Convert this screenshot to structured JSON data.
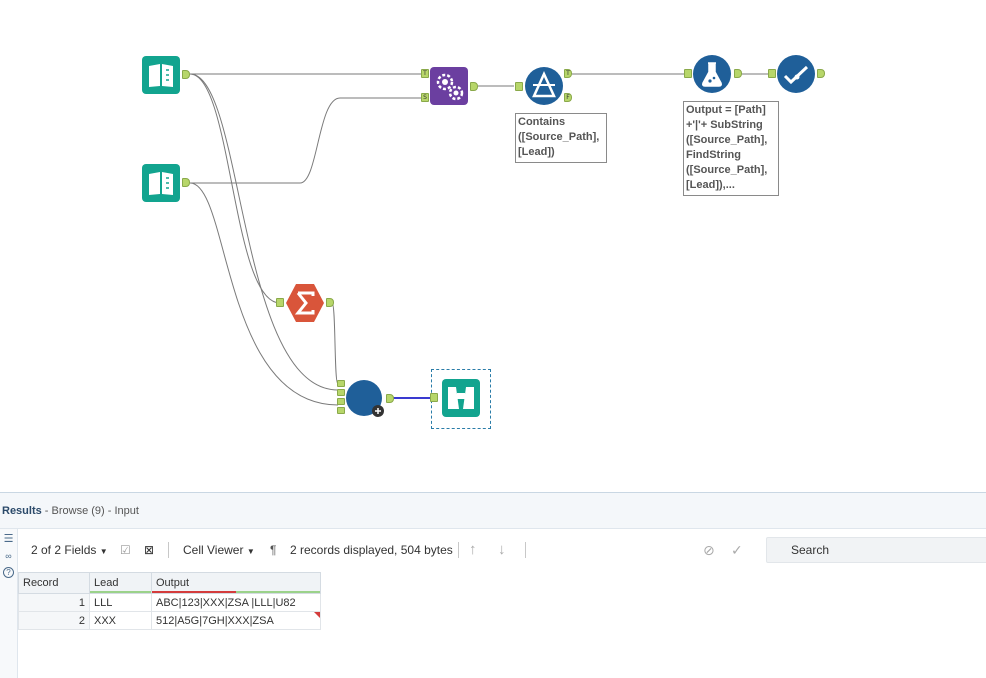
{
  "annotations": {
    "filter": "Contains\n([Source_Path],\n[Lead])",
    "formula": "Output = [Path]\n+'|'+ SubString\n([Source_Path],\nFindString\n([Source_Path],\n[Lead]),..."
  },
  "anchors": {
    "true": "T",
    "false": "F",
    "source": "S"
  },
  "results": {
    "title": "Results",
    "subtitle": " - Browse (9) - Input",
    "fields_label": "2 of 2 Fields",
    "cell_viewer_label": "Cell Viewer",
    "records_info": "2 records displayed, 504 bytes",
    "search_placeholder": "Search",
    "columns": [
      "Record",
      "Lead",
      "Output"
    ],
    "rows": [
      {
        "record": "1",
        "lead": "LLL",
        "output": "ABC|123|XXX|ZSA |LLL|U82"
      },
      {
        "record": "2",
        "lead": "XXX",
        "output": "512|A5G|7GH|XXX|ZSA"
      }
    ]
  },
  "colors": {
    "input_tool": "#12a48f",
    "dynamic_tool": "#6b3fa0",
    "filter_tool": "#1f5f99",
    "summarize_tool": "#d9553a",
    "join_tool": "#1f5f99",
    "anchor": "#b7d66a",
    "wire": "#7a7a7a",
    "selected_wire": "#3a3ad0"
  }
}
